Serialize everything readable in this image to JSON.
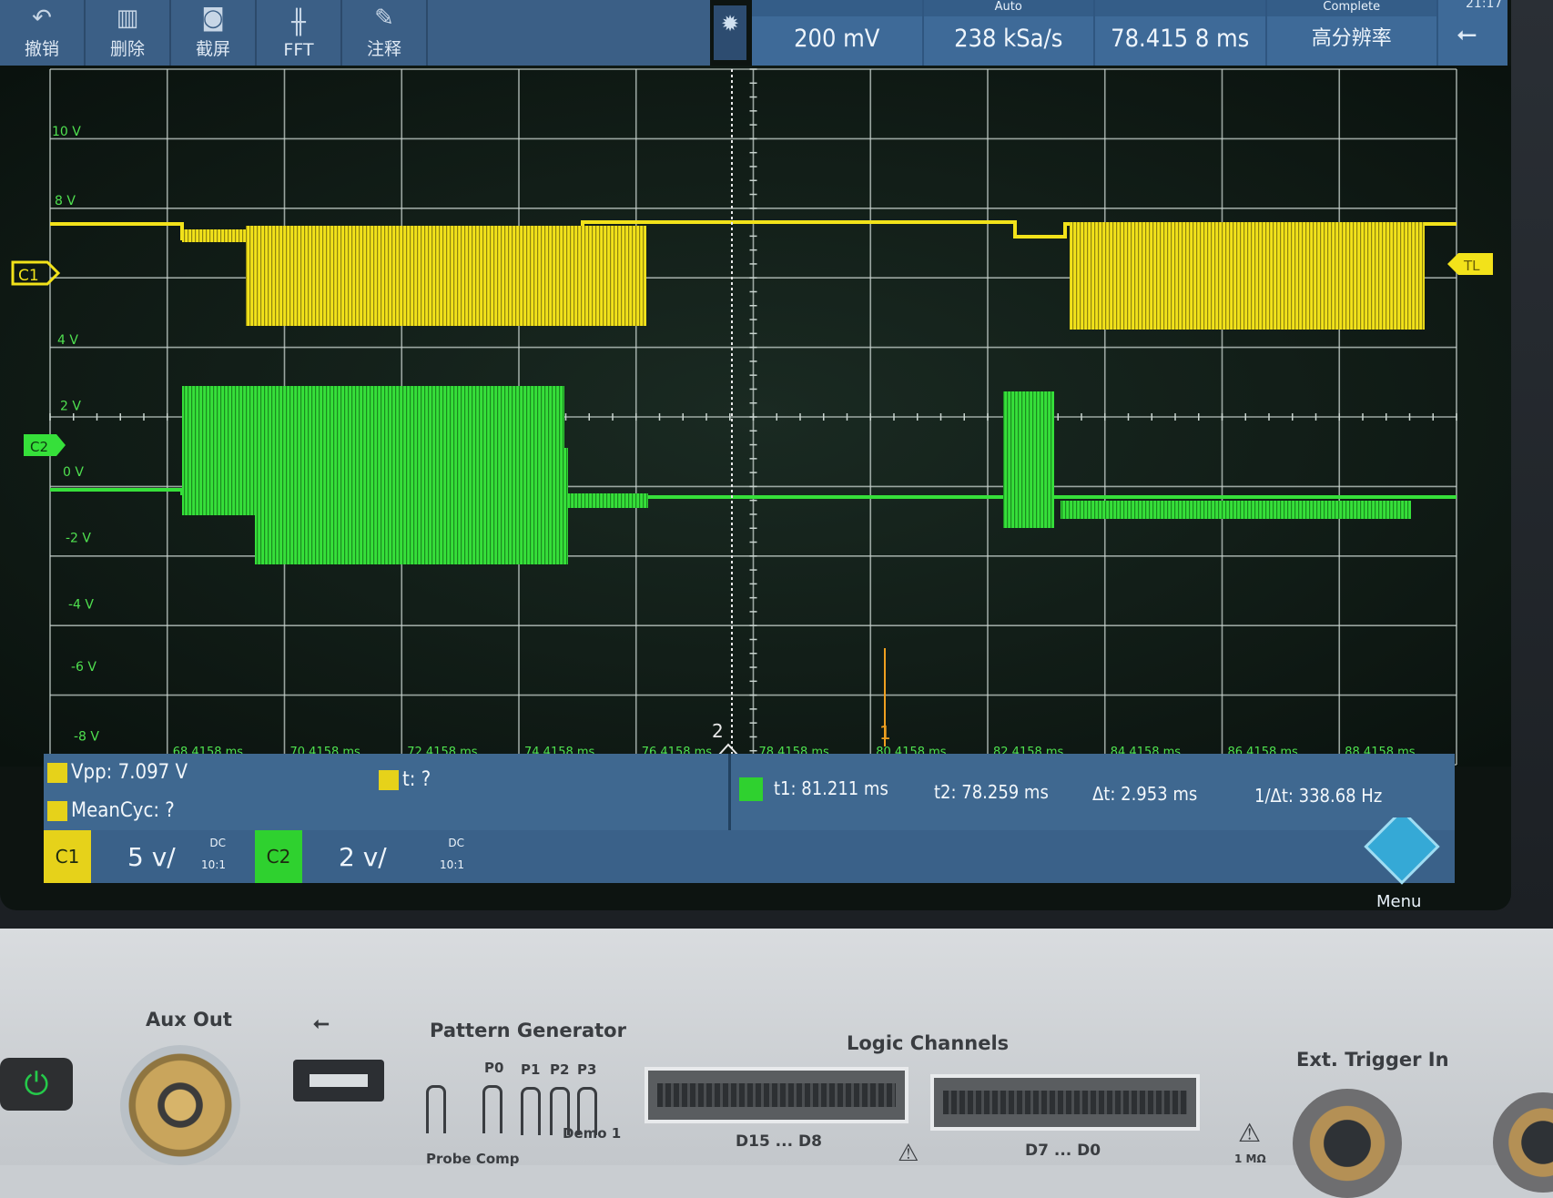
{
  "toolbar": {
    "items": [
      {
        "label": "撤销",
        "icon": "undo-icon"
      },
      {
        "label": "删除",
        "icon": "trash-icon"
      },
      {
        "label": "截屏",
        "icon": "camera-icon"
      },
      {
        "label": "FFT",
        "icon": "fft-icon"
      },
      {
        "label": "注释",
        "icon": "pencil-icon"
      }
    ]
  },
  "status": {
    "cells": [
      {
        "top": "",
        "value": "200 mV"
      },
      {
        "top": "Auto",
        "value": "238 kSa/s"
      },
      {
        "top": "",
        "value": "78.415 8 ms"
      },
      {
        "top": "Complete",
        "value": "高分辨率"
      }
    ],
    "clock": "21:17"
  },
  "plot": {
    "voltage_labels": [
      "10 V",
      "8 V",
      "4 V",
      "2 V",
      "0 V",
      "-2 V",
      "-4 V",
      "-6 V",
      "-8 V"
    ],
    "time_labels": [
      "68.4158 ms",
      "70.4158 ms",
      "72.4158 ms",
      "74.4158 ms",
      "76.4158 ms",
      "78.4158 ms",
      "80.4158 ms",
      "82.4158 ms",
      "84.4158 ms",
      "86.4158 ms",
      "88.4158 ms"
    ],
    "ch1_marker": "C1",
    "ch2_marker": "C2",
    "trigger_marker": "TL",
    "cursor_labels": [
      "2",
      "1"
    ],
    "trace_colors": {
      "ch1": "#f2e21a",
      "ch2": "#36e03a"
    }
  },
  "measurements": {
    "vpp": "Vpp: 7.097 V",
    "meancyc": "MeanCyc: ?",
    "t_unknown": "t: ?",
    "t1": "t1: 81.211 ms",
    "t2": "t2: 78.259 ms",
    "dt": "Δt: 2.953 ms",
    "inv_dt": "1/Δt: 338.68 Hz"
  },
  "channels": [
    {
      "label": "C1",
      "scale": "5 v/",
      "coupling": "DC",
      "probe": "10:1",
      "color": "#e6d21a"
    },
    {
      "label": "C2",
      "scale": "2 v/",
      "coupling": "DC",
      "probe": "10:1",
      "color": "#2fd12f"
    }
  ],
  "menu_label": "Menu",
  "panel": {
    "aux_out": "Aux Out",
    "pattern_generator": "Pattern Generator",
    "pattern_pins": [
      "P0",
      "P1",
      "P2",
      "P3"
    ],
    "demo": "Demo 1",
    "probe_comp": "Probe Comp",
    "logic_channels": "Logic Channels",
    "d15_d8": "D15 ... D8",
    "d7_d0": "D7 ... D0",
    "ext_trigger": "Ext. Trigger In",
    "impedance": "1 MΩ"
  }
}
